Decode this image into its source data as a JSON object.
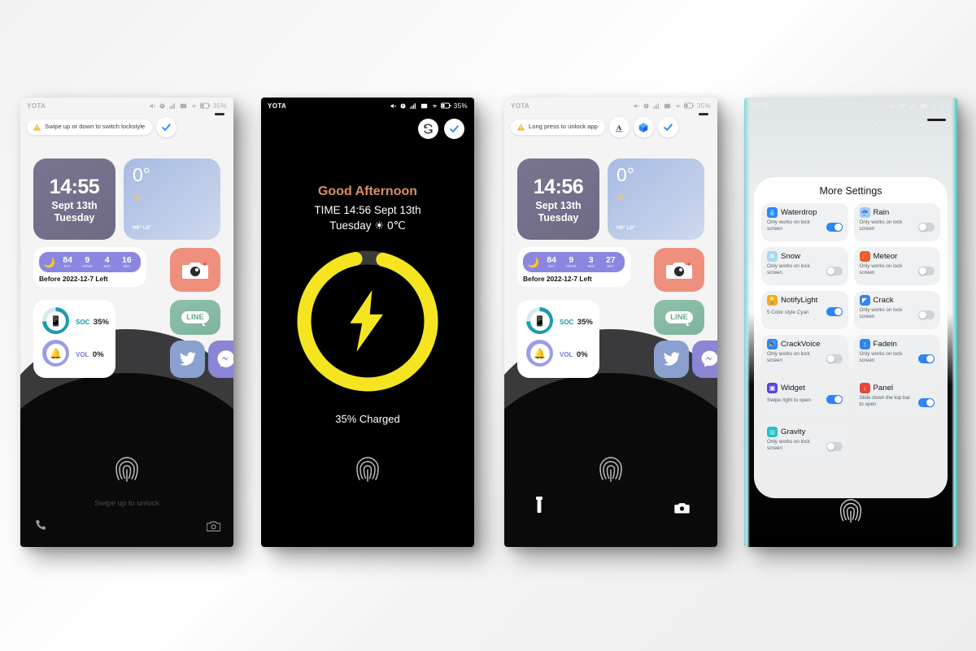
{
  "statusbar": {
    "carrier": "YOTA",
    "battery_pct": "35%",
    "icons": [
      "mute-icon",
      "alarm-icon",
      "signal-icon",
      "vibrate-icon",
      "wifi-icon",
      "battery-icon"
    ]
  },
  "phone1": {
    "tip": "Swipe up or down to switch lockstyle",
    "clock": {
      "time": "14:55",
      "date": "Sept 13th",
      "weekday": "Tuesday"
    },
    "weather": {
      "temp": "0°",
      "condition_icon": "sun-icon",
      "hilo": "H0° L0°"
    },
    "countdown": {
      "moon_icon": "moon-timer-icon",
      "units": [
        {
          "value": "84",
          "label": "DAY"
        },
        {
          "value": "9",
          "label": "HOUR"
        },
        {
          "value": "4",
          "label": "MIN"
        },
        {
          "value": "16",
          "label": "SEC"
        }
      ],
      "label": "Before 2022-12-7 Left"
    },
    "status": [
      {
        "key": "SOC",
        "value": "35%",
        "icon": "battery-ring-icon",
        "color": "#1a9bb0",
        "pct": 74
      },
      {
        "key": "VOL",
        "value": "0%",
        "icon": "bell-ring-icon",
        "color": "#9b9ce8",
        "pct": 100
      }
    ],
    "apps": [
      {
        "name": "LINE",
        "label": "LINE",
        "color": "#8ec0a8"
      },
      {
        "name": "Twitter",
        "label": "",
        "color": "#8aa0cf"
      },
      {
        "name": "Messenger",
        "label": "",
        "color": "#8b85d6"
      }
    ],
    "camera_tile_icon": "camera-icon",
    "unlock_text": "Swipe up to unlock",
    "bottom_left_icon": "phone-icon",
    "bottom_right_icon": "camera-icon",
    "fingerprint_icon": "fingerprint-icon",
    "header_buttons": [
      "check-icon"
    ]
  },
  "phone2": {
    "greeting": "Good Afternoon",
    "time_line": "TIME 14:56 Sept 13th",
    "day_line": "Tuesday ☀ 0℃",
    "charge_pct": 93,
    "charged_text": "35% Charged",
    "bolt_icon": "lightning-bolt-icon",
    "ring_color": "#f5e521",
    "ring_track_color": "#3a3a3a",
    "header_buttons": [
      "refresh-icon",
      "check-icon"
    ],
    "fingerprint_icon": "fingerprint-icon"
  },
  "phone3": {
    "tip": "Long press to unlock app",
    "clock": {
      "time": "14:56",
      "date": "Sept 13th",
      "weekday": "Tuesday"
    },
    "weather": {
      "temp": "0°",
      "condition_icon": "sun-icon",
      "hilo": "H0° L0°"
    },
    "countdown": {
      "moon_icon": "moon-timer-icon",
      "units": [
        {
          "value": "84",
          "label": "DAY"
        },
        {
          "value": "9",
          "label": "HOUR"
        },
        {
          "value": "3",
          "label": "MIN"
        },
        {
          "value": "27",
          "label": "SEC"
        }
      ],
      "label": "Before 2022-12-7 Left"
    },
    "status": [
      {
        "key": "SOC",
        "value": "35%",
        "icon": "battery-ring-icon",
        "color": "#1a9bb0",
        "pct": 74
      },
      {
        "key": "VOL",
        "value": "0%",
        "icon": "bell-ring-icon",
        "color": "#9b9ce8",
        "pct": 100
      }
    ],
    "apps": [
      {
        "name": "LINE",
        "label": "LINE",
        "color": "#8ec0a8"
      },
      {
        "name": "Twitter",
        "label": "",
        "color": "#8aa0cf"
      },
      {
        "name": "Messenger",
        "label": "",
        "color": "#8b85d6"
      }
    ],
    "camera_tile_icon": "camera-icon",
    "bottom_left_icon": "flashlight-icon",
    "bottom_right_icon": "camera-icon",
    "fingerprint_icon": "fingerprint-icon",
    "header_buttons": [
      "font-icon",
      "cube-icon",
      "check-icon"
    ]
  },
  "phone4": {
    "panel_title": "More Settings",
    "effects": [
      {
        "name": "Waterdrop",
        "sub": "Only works on lock screen",
        "on": true,
        "icon": "waterdrop-icon",
        "icon_glyph": "💧",
        "icon_bg": "#2f84f7"
      },
      {
        "name": "Rain",
        "sub": "Only works on lock screen",
        "on": false,
        "icon": "rain-cloud-icon",
        "icon_glyph": "☔",
        "icon_bg": "#9ccdf2"
      },
      {
        "name": "Snow",
        "sub": "Only works on lock screen",
        "on": false,
        "icon": "snow-icon",
        "icon_glyph": "❄",
        "icon_bg": "#a9d8f5"
      },
      {
        "name": "Meteor",
        "sub": "Only works on lock screen",
        "on": false,
        "icon": "meteor-icon",
        "icon_glyph": "☄",
        "icon_bg": "#f05a28"
      },
      {
        "name": "NotifyLight",
        "sub": "5 Color style Cyan",
        "on": true,
        "icon": "bulb-icon",
        "icon_glyph": "💡",
        "icon_bg": "#f7a729"
      },
      {
        "name": "Crack",
        "sub": "Only works on lock screen",
        "on": false,
        "icon": "crack-icon",
        "icon_glyph": "◤",
        "icon_bg": "#2f84f7"
      },
      {
        "name": "CrackVoice",
        "sub": "Only works on lock screen",
        "on": false,
        "icon": "speaker-icon",
        "icon_glyph": "🔊",
        "icon_bg": "#2f84f7"
      },
      {
        "name": "Fadein",
        "sub": "Only works on lock screen",
        "on": true,
        "icon": "fadein-icon",
        "icon_glyph": "↕",
        "icon_bg": "#2f84f7"
      },
      {
        "name": "Widget",
        "sub": "Swipe right to open",
        "on": true,
        "icon": "widget-icon",
        "icon_glyph": "▣",
        "icon_bg": "#5b45d6"
      },
      {
        "name": "Panel",
        "sub": "Slide down the top bar to open",
        "on": true,
        "icon": "panel-icon",
        "icon_glyph": "↓",
        "icon_bg": "#e8453c"
      },
      {
        "name": "Gravity",
        "sub": "Only works on lock screen",
        "on": false,
        "icon": "gravity-icon",
        "icon_glyph": "◎",
        "icon_bg": "#22c3c3"
      }
    ],
    "fingerprint_icon": "fingerprint-icon"
  }
}
